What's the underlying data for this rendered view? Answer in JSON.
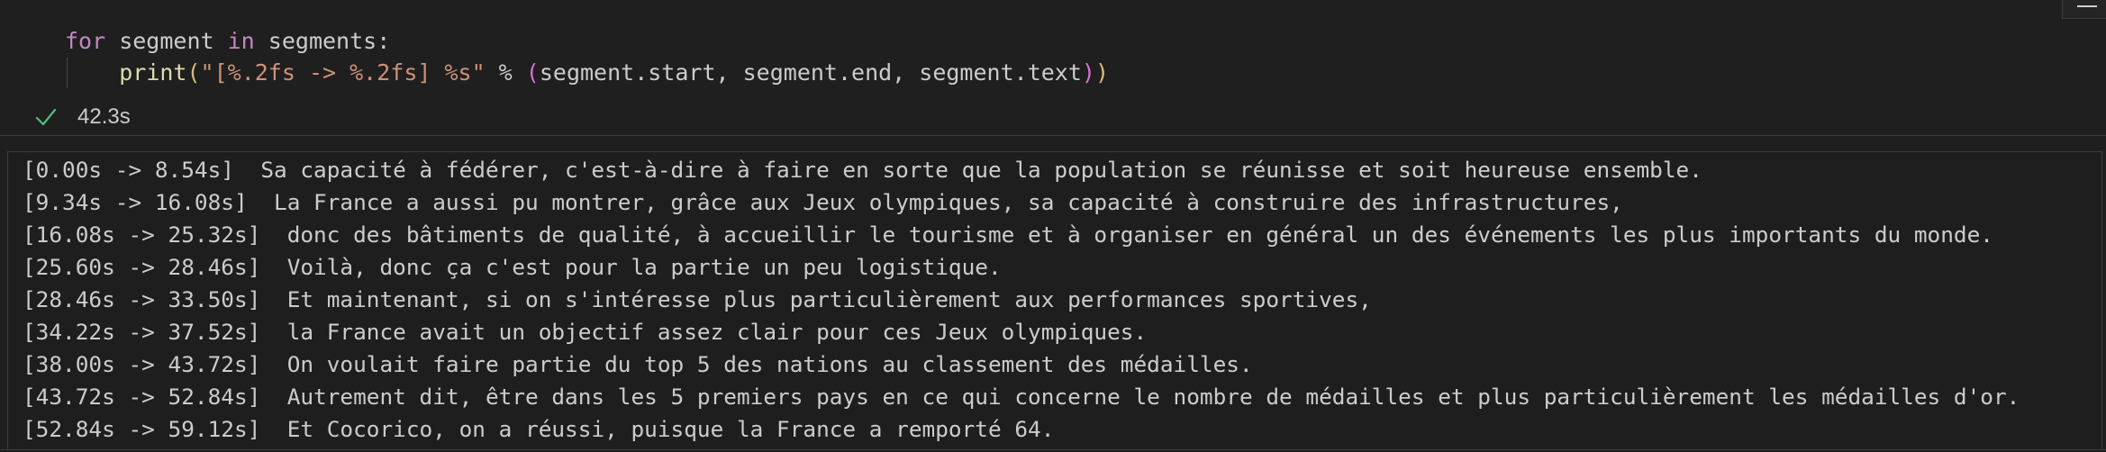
{
  "code_cell": {
    "line1": {
      "kw_for": "for",
      "var": " segment ",
      "kw_in": "in",
      "rest": " segments:"
    },
    "line2": {
      "fn": "print",
      "open": "(",
      "string": "\"[%.2fs -> %.2fs] %s\"",
      "op": " % ",
      "open2": "(",
      "args": "segment.start, segment.end, segment.text",
      "close2": ")",
      "close": ")"
    }
  },
  "execution": {
    "status_icon": "check-icon",
    "time": "42.3s",
    "color": "#4ec07e"
  },
  "output": {
    "lines": [
      "[0.00s -> 8.54s]  Sa capacité à fédérer, c'est-à-dire à faire en sorte que la population se réunisse et soit heureuse ensemble.",
      "[9.34s -> 16.08s]  La France a aussi pu montrer, grâce aux Jeux olympiques, sa capacité à construire des infrastructures,",
      "[16.08s -> 25.32s]  donc des bâtiments de qualité, à accueillir le tourisme et à organiser en général un des événements les plus importants du monde.",
      "[25.60s -> 28.46s]  Voilà, donc ça c'est pour la partie un peu logistique.",
      "[28.46s -> 33.50s]  Et maintenant, si on s'intéresse plus particulièrement aux performances sportives,",
      "[34.22s -> 37.52s]  la France avait un objectif assez clair pour ces Jeux olympiques.",
      "[38.00s -> 43.72s]  On voulait faire partie du top 5 des nations au classement des médailles.",
      "[43.72s -> 52.84s]  Autrement dit, être dans les 5 premiers pays en ce qui concerne le nombre de médailles et plus particulièrement les médailles d'or.",
      "[52.84s -> 59.12s]  Et Cocorico, on a réussi, puisque la France a remporté 64."
    ]
  }
}
